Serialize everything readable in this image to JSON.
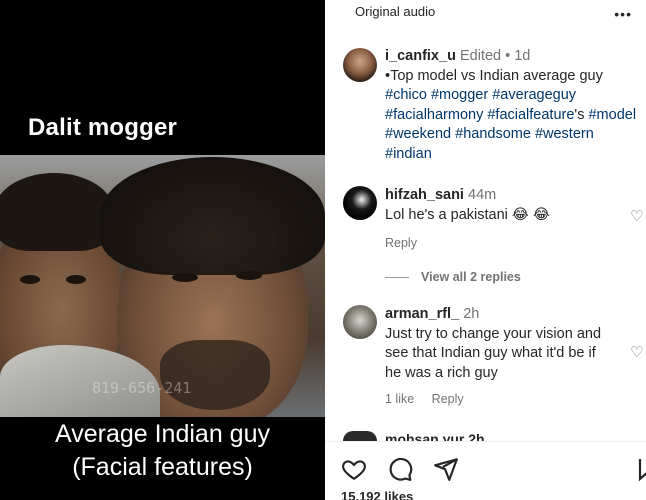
{
  "media": {
    "caption_top": "Dalit mogger",
    "caption_bottom_line1": "Average Indian guy",
    "caption_bottom_line2": "(Facial features)",
    "video_stamp": "819-656-241"
  },
  "header": {
    "audio_label": "Original audio",
    "more_icon": "more-icon"
  },
  "post": {
    "username": "i_canfix_u",
    "edited": "Edited",
    "separator": "•",
    "time": "1d",
    "text": "•Top model vs Indian average guy",
    "hashtags_line1": [
      "#chico",
      "#mogger",
      "#averageguy"
    ],
    "hashtags_line2": [
      "#facialharmony",
      "#facialfeature",
      "'s",
      "#model"
    ],
    "hashtags_line3": [
      "#weekend",
      "#handsome",
      "#western"
    ],
    "hashtags_line4": [
      "#indian"
    ]
  },
  "comments": [
    {
      "username": "hifzah_sani",
      "time": "44m",
      "text": "Lol he's a pakistani 😂 😂",
      "reply_label": "Reply",
      "view_replies": "View all 2 replies"
    },
    {
      "username": "arman_rfl_",
      "time": "2h",
      "text_line1": "Just try to change your vision and",
      "text_line2": "see that Indian guy what it'd be if",
      "text_line3": "he was a rich guy",
      "likes_label": "1 like",
      "reply_label": "Reply"
    },
    {
      "username_partial": "mohsan yur",
      "time_partial": "2h"
    }
  ],
  "footer": {
    "like_count": "15,192 likes",
    "icons": [
      "heart-icon",
      "comment-icon",
      "share-icon",
      "bookmark-icon"
    ]
  },
  "colors": {
    "hashtag": "#00376b",
    "text": "#262626",
    "muted": "#737373",
    "media_bg": "#000000"
  }
}
